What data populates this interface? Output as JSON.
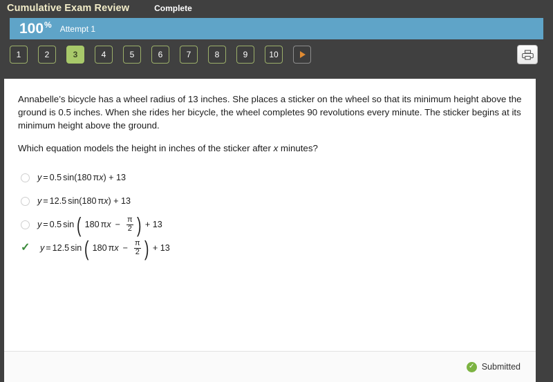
{
  "header": {
    "title": "Cumulative Exam Review",
    "status": "Complete"
  },
  "score_bar": {
    "percent_value": "100",
    "percent_symbol": "%",
    "attempt_label": "Attempt 1",
    "bar_color": "#5fa4c8"
  },
  "question_nav": {
    "items": [
      "1",
      "2",
      "3",
      "4",
      "5",
      "6",
      "7",
      "8",
      "9",
      "10"
    ],
    "active_index": 2,
    "active_color": "#a8c96a",
    "border_color": "#9cb06a",
    "next_icon": "play-triangle-icon",
    "next_icon_color": "#e08b32",
    "print_icon": "printer-icon"
  },
  "question": {
    "paragraph": "Annabelle’s bicycle has a wheel radius of 13 inches. She places a sticker on the wheel so that its minimum height above the ground is 0.5 inches. When she rides her bicycle, the wheel completes 90 revolutions every minute. The sticker begins at its minimum height above the ground.",
    "prompt_before": "Which equation models the height in inches of the sticker after ",
    "prompt_variable": "x",
    "prompt_after": " minutes?"
  },
  "choices": [
    {
      "marker": "radio-unselected",
      "lhs": "y",
      "eq": "=",
      "amplitude": "0.5",
      "fn": "sin(180",
      "pi": "π",
      "var": "x",
      "close": ") + 13",
      "has_fraction": false,
      "selected": false
    },
    {
      "marker": "radio-unselected",
      "lhs": "y",
      "eq": "=",
      "amplitude": "12.5",
      "fn": "sin(180",
      "pi": "π",
      "var": "x",
      "close": ") + 13",
      "has_fraction": false,
      "selected": false
    },
    {
      "marker": "radio-unselected",
      "lhs": "y",
      "eq": "=",
      "amplitude": "0.5",
      "fn": "sin",
      "inner_prefix": "180",
      "pi": "π",
      "var": "x",
      "minus": "−",
      "frac_num": "π",
      "frac_den": "2",
      "close": "+ 13",
      "has_fraction": true,
      "selected": false
    },
    {
      "marker": "check-icon",
      "lhs": "y",
      "eq": "=",
      "amplitude": "12.5",
      "fn": "sin",
      "inner_prefix": "180",
      "pi": "π",
      "var": "x",
      "minus": "−",
      "frac_num": "π",
      "frac_den": "2",
      "close": "+ 13",
      "has_fraction": true,
      "selected": true,
      "check_color": "#3a8a3a"
    }
  ],
  "footer": {
    "status_icon": "check-circle-icon",
    "status_label": "Submitted",
    "status_color": "#7cb342"
  }
}
